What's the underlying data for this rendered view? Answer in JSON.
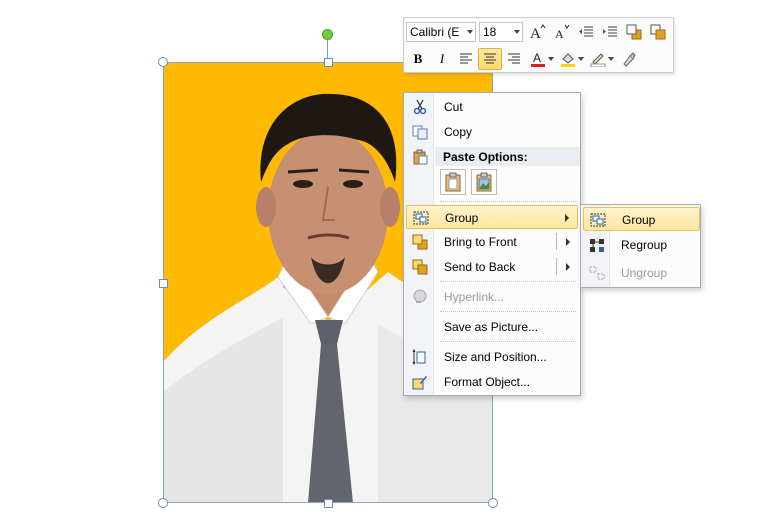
{
  "mini_toolbar": {
    "font_name": "Calibri (E",
    "font_size": "18",
    "buttons_row1": [
      "grow-font-icon",
      "shrink-font-icon",
      "decrease-indent-icon",
      "increase-indent-icon",
      "bring-forward-icon",
      "send-backward-icon"
    ],
    "bold_label": "B",
    "italic_label": "I",
    "font_color": "#d92020",
    "fill_color": "#ffd200",
    "active_button": "center-align"
  },
  "context_menu": {
    "items": [
      {
        "label": "Cut",
        "icon": "scissors-icon",
        "enabled": true
      },
      {
        "label": "Copy",
        "icon": "copy-icon",
        "enabled": true
      },
      {
        "label": "Paste Options:",
        "icon": "paste-icon",
        "header": true
      },
      {
        "label": "Group",
        "icon": "group-icon",
        "enabled": true,
        "submenu": true,
        "highlighted": true
      },
      {
        "label": "Bring to Front",
        "icon": "bring-to-front-icon",
        "enabled": true,
        "submenu": true
      },
      {
        "label": "Send to Back",
        "icon": "send-to-back-icon",
        "enabled": true,
        "submenu": true
      },
      {
        "label": "Hyperlink...",
        "icon": "hyperlink-icon",
        "enabled": false
      },
      {
        "label": "Save as Picture...",
        "enabled": true
      },
      {
        "label": "Size and Position...",
        "icon": "size-position-icon",
        "enabled": true
      },
      {
        "label": "Format Object...",
        "icon": "format-object-icon",
        "enabled": true
      }
    ]
  },
  "group_submenu": {
    "items": [
      {
        "label": "Group",
        "icon": "group-icon",
        "enabled": true,
        "highlighted": true
      },
      {
        "label": "Regroup",
        "icon": "regroup-icon",
        "enabled": true
      },
      {
        "label": "Ungroup",
        "icon": "ungroup-icon",
        "enabled": false
      }
    ]
  },
  "colors": {
    "photo_background": "#ffb900",
    "menu_highlight": "#fde6a0",
    "selection_border": "#8aa3c8"
  }
}
